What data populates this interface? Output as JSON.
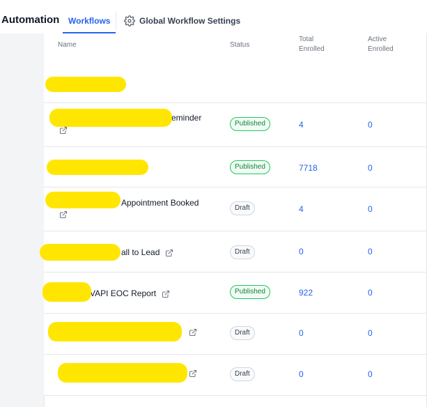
{
  "header": {
    "app_title": "Automation",
    "tab_workflows": "Workflows",
    "tab_settings": "Global Workflow Settings"
  },
  "table": {
    "columns": {
      "name": "Name",
      "status": "Status",
      "total_line1": "Total",
      "total_line2": "Enrolled",
      "active_line1": "Active",
      "active_line2": "Enrolled"
    },
    "rows": [
      {
        "name": "",
        "status": "",
        "total": "",
        "active": ""
      },
      {
        "name": "eminder",
        "status": "Published",
        "total": "4",
        "active": "0"
      },
      {
        "name": "",
        "status": "Published",
        "total": "7718",
        "active": "0"
      },
      {
        "name": "Appointment Booked",
        "status": "Draft",
        "total": "4",
        "active": "0"
      },
      {
        "name": "all to Lead",
        "status": "Draft",
        "total": "0",
        "active": "0"
      },
      {
        "name": "VAPI EOC Report",
        "status": "Published",
        "total": "922",
        "active": "0"
      },
      {
        "name": "",
        "status": "Draft",
        "total": "0",
        "active": "0"
      },
      {
        "name": "",
        "status": "Draft",
        "total": "0",
        "active": "0"
      }
    ]
  },
  "colors": {
    "accent": "#2563eb",
    "published_border": "#22c55e",
    "redaction": "#ffe600"
  }
}
